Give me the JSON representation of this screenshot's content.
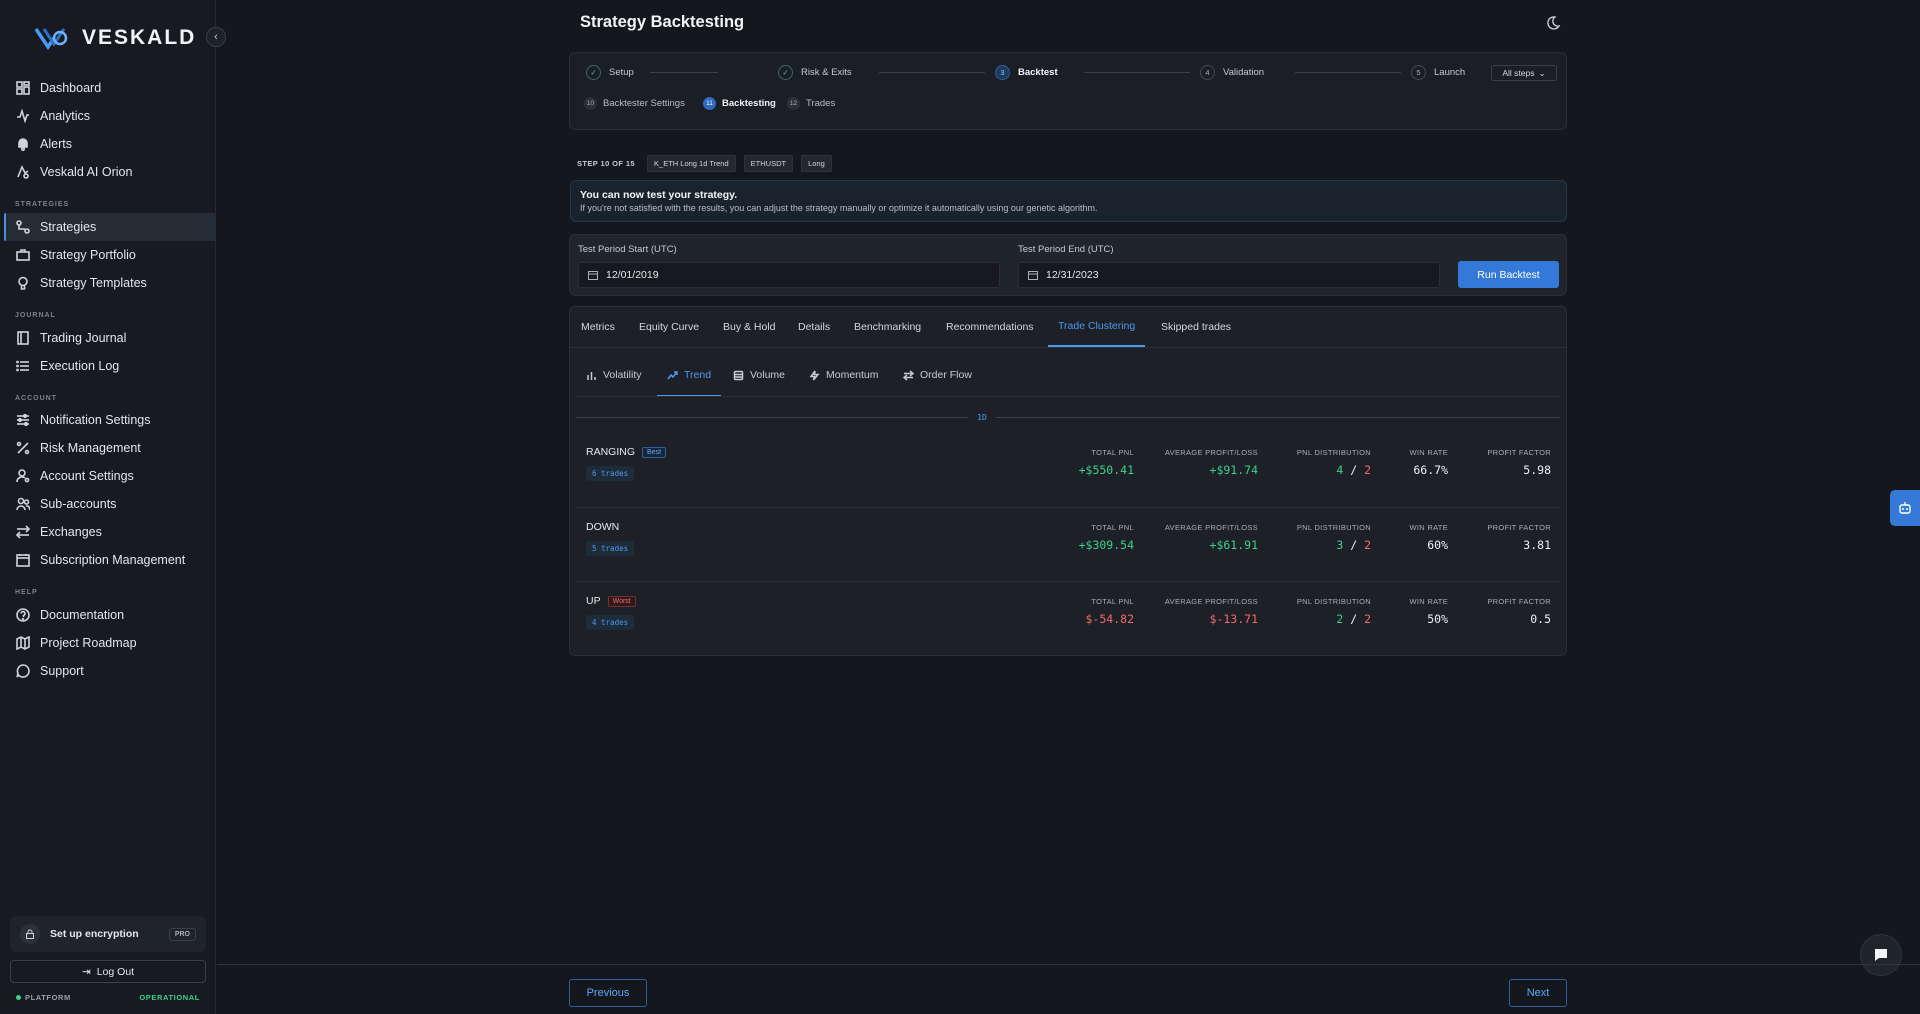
{
  "brand": {
    "name": "VESKALD"
  },
  "sidebar": {
    "main_items": [
      {
        "label": "Dashboard",
        "icon": "dashboard-icon"
      },
      {
        "label": "Analytics",
        "icon": "analytics-icon"
      },
      {
        "label": "Alerts",
        "icon": "bell-icon"
      },
      {
        "label": "Veskald AI Orion",
        "icon": "ai-icon"
      }
    ],
    "sections": {
      "strategies": "STRATEGIES",
      "journal": "JOURNAL",
      "account": "ACCOUNT",
      "help": "HELP"
    },
    "strategy_items": [
      {
        "label": "Strategies",
        "icon": "strategies-icon",
        "active": true
      },
      {
        "label": "Strategy Portfolio",
        "icon": "briefcase-icon"
      },
      {
        "label": "Strategy Templates",
        "icon": "lightbulb-icon"
      }
    ],
    "journal_items": [
      {
        "label": "Trading Journal",
        "icon": "book-icon"
      },
      {
        "label": "Execution Log",
        "icon": "list-icon"
      }
    ],
    "account_items": [
      {
        "label": "Notification Settings",
        "icon": "sliders-icon"
      },
      {
        "label": "Risk Management",
        "icon": "percent-icon"
      },
      {
        "label": "Account Settings",
        "icon": "user-gear-icon"
      },
      {
        "label": "Sub-accounts",
        "icon": "users-icon"
      },
      {
        "label": "Exchanges",
        "icon": "exchange-icon"
      },
      {
        "label": "Subscription Management",
        "icon": "calendar-icon"
      }
    ],
    "help_items": [
      {
        "label": "Documentation",
        "icon": "help-circle-icon"
      },
      {
        "label": "Project Roadmap",
        "icon": "map-icon"
      },
      {
        "label": "Support",
        "icon": "chat-bubble-icon"
      }
    ],
    "encryption": {
      "label": "Set up encryption",
      "badge": "PRO"
    },
    "logout": "Log Out",
    "platform": {
      "label": "PLATFORM",
      "status": "OPERATIONAL"
    }
  },
  "page": {
    "title": "Strategy Backtesting"
  },
  "stepper": {
    "steps": [
      {
        "num": "1",
        "label": "Setup",
        "state": "done"
      },
      {
        "num": "2",
        "label": "Risk & Exits",
        "state": "done"
      },
      {
        "num": "3",
        "label": "Backtest",
        "state": "current"
      },
      {
        "num": "4",
        "label": "Validation",
        "state": "pending"
      },
      {
        "num": "5",
        "label": "Launch",
        "state": "pending"
      }
    ],
    "all_steps": "All steps",
    "substeps": [
      {
        "num": "10",
        "label": "Backtester Settings"
      },
      {
        "num": "11",
        "label": "Backtesting",
        "active": true
      },
      {
        "num": "12",
        "label": "Trades"
      }
    ]
  },
  "step_meta": {
    "count": "STEP 10 OF 15",
    "chips": [
      "K_ETH Long 1d Trend",
      "ETHUSDT",
      "Long"
    ]
  },
  "info": {
    "title": "You can now test your strategy.",
    "text": "If you're not satisfied with the results, you can adjust the strategy manually or optimize it automatically using our genetic algorithm."
  },
  "period": {
    "start_label": "Test Period Start (UTC)",
    "start_value": "12/01/2019",
    "end_label": "Test Period End (UTC)",
    "end_value": "12/31/2023",
    "run_label": "Run Backtest"
  },
  "tabs": [
    "Metrics",
    "Equity Curve",
    "Buy & Hold",
    "Details",
    "Benchmarking",
    "Recommendations",
    "Trade Clustering",
    "Skipped trades"
  ],
  "active_tab": "Trade Clustering",
  "subtabs": [
    {
      "label": "Volatility",
      "icon": "bar-chart-icon"
    },
    {
      "label": "Trend",
      "icon": "trend-up-icon",
      "active": true
    },
    {
      "label": "Volume",
      "icon": "database-icon"
    },
    {
      "label": "Momentum",
      "icon": "zap-icon"
    },
    {
      "label": "Order Flow",
      "icon": "arrows-icon"
    }
  ],
  "timeframe": "1D",
  "metric_labels": {
    "total_pnl": "TOTAL PNL",
    "avg_pl": "AVERAGE PROFIT/LOSS",
    "pnl_dist": "PNL DISTRIBUTION",
    "win_rate": "WIN RATE",
    "profit_factor": "PROFIT FACTOR"
  },
  "clusters": [
    {
      "name": "RANGING",
      "tag": "Best",
      "tag_type": "best",
      "trades": "6 trades",
      "total_pnl": "+$550.41",
      "avg_pl": "+$91.74",
      "wins": "4",
      "sep": "/",
      "losses": "2",
      "win_rate": "66.7%",
      "profit_factor": "5.98",
      "sign": "pos"
    },
    {
      "name": "DOWN",
      "tag": "",
      "tag_type": "",
      "trades": "5 trades",
      "total_pnl": "+$309.54",
      "avg_pl": "+$61.91",
      "wins": "3",
      "sep": "/",
      "losses": "2",
      "win_rate": "60%",
      "profit_factor": "3.81",
      "sign": "pos"
    },
    {
      "name": "UP",
      "tag": "Worst",
      "tag_type": "worst",
      "trades": "4 trades",
      "total_pnl": "$-54.82",
      "avg_pl": "$-13.71",
      "wins": "2",
      "sep": "/",
      "losses": "2",
      "win_rate": "50%",
      "profit_factor": "0.5",
      "sign": "neg"
    }
  ],
  "footer": {
    "previous": "Previous",
    "next": "Next"
  },
  "colors": {
    "accent": "#3579d8",
    "positive": "#3fcf8e",
    "negative": "#f06a6a"
  }
}
